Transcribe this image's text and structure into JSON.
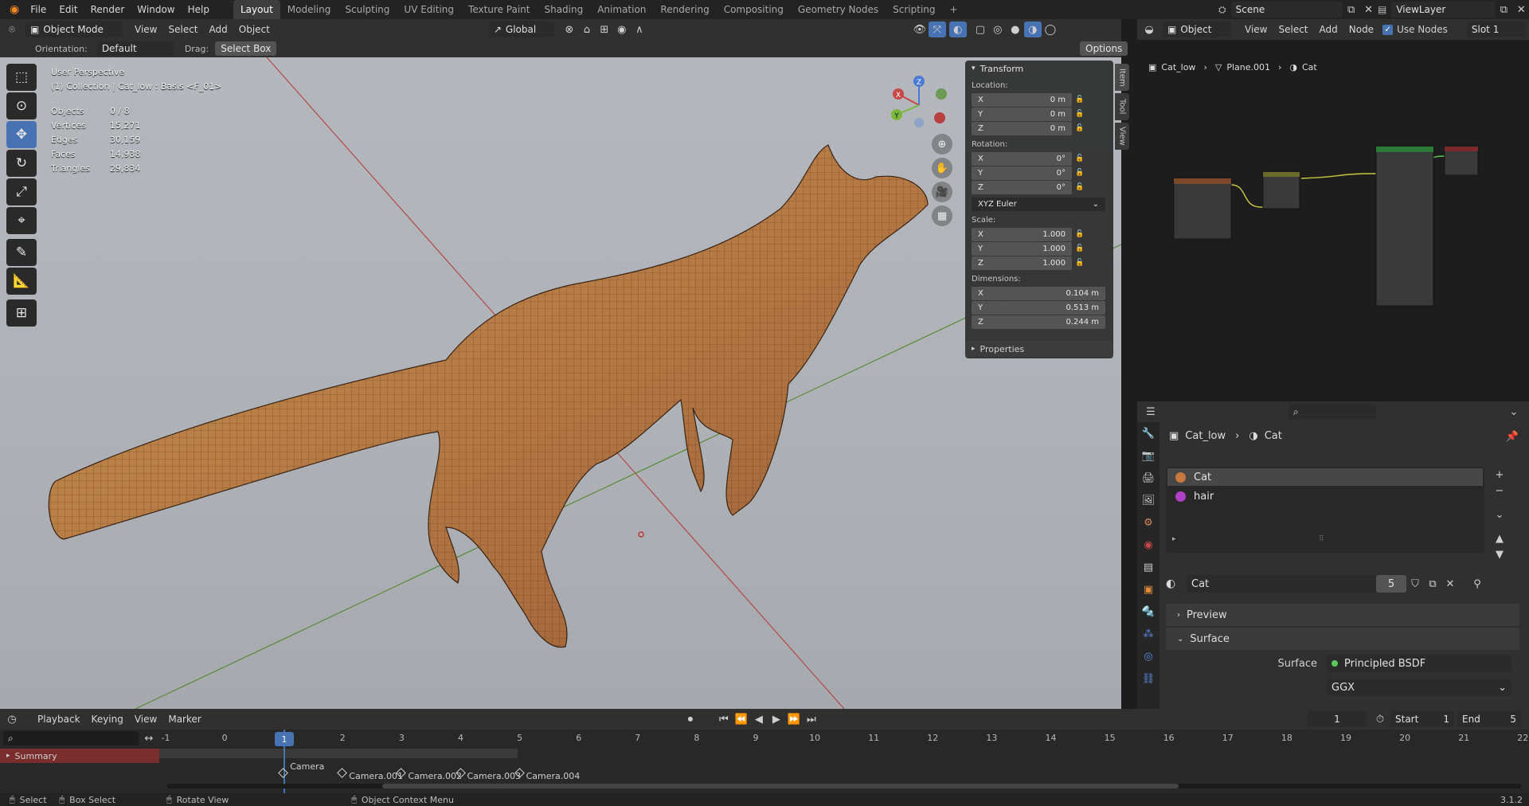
{
  "topbar": {
    "menus": [
      "File",
      "Edit",
      "Render",
      "Window",
      "Help"
    ],
    "workspaces": [
      "Layout",
      "Modeling",
      "Sculpting",
      "UV Editing",
      "Texture Paint",
      "Shading",
      "Animation",
      "Rendering",
      "Compositing",
      "Geometry Nodes",
      "Scripting"
    ],
    "active_workspace": "Layout",
    "scene": "Scene",
    "view_layer": "ViewLayer"
  },
  "viewport_header": {
    "mode": "Object Mode",
    "menus": [
      "View",
      "Select",
      "Add",
      "Object"
    ],
    "transform_orientation": "Global"
  },
  "tool_settings": {
    "orientation_label": "Orientation:",
    "orientation_value": "Default",
    "drag_label": "Drag:",
    "drag_value": "Select Box",
    "options": "Options"
  },
  "overlay": {
    "view_name": "User Perspective",
    "collection_path": "(1) Collection | Cat_low : Basis <F_01>",
    "stats": [
      {
        "label": "Objects",
        "value": "0 / 8"
      },
      {
        "label": "Vertices",
        "value": "15,271"
      },
      {
        "label": "Edges",
        "value": "30,159"
      },
      {
        "label": "Faces",
        "value": "14,938"
      },
      {
        "label": "Triangles",
        "value": "29,834"
      }
    ]
  },
  "gizmo_axes": {
    "x": "X",
    "y": "Y",
    "z": "Z"
  },
  "npanel": {
    "title": "Transform",
    "location_label": "Location:",
    "location": [
      {
        "axis": "X",
        "value": "0 m"
      },
      {
        "axis": "Y",
        "value": "0 m"
      },
      {
        "axis": "Z",
        "value": "0 m"
      }
    ],
    "rotation_label": "Rotation:",
    "rotation": [
      {
        "axis": "X",
        "value": "0°"
      },
      {
        "axis": "Y",
        "value": "0°"
      },
      {
        "axis": "Z",
        "value": "0°"
      }
    ],
    "rotation_mode": "XYZ Euler",
    "scale_label": "Scale:",
    "scale": [
      {
        "axis": "X",
        "value": "1.000"
      },
      {
        "axis": "Y",
        "value": "1.000"
      },
      {
        "axis": "Z",
        "value": "1.000"
      }
    ],
    "dimensions_label": "Dimensions:",
    "dimensions": [
      {
        "axis": "X",
        "value": "0.104 m"
      },
      {
        "axis": "Y",
        "value": "0.513 m"
      },
      {
        "axis": "Z",
        "value": "0.244 m"
      }
    ],
    "properties": "Properties",
    "tabs": [
      "Item",
      "Tool",
      "View"
    ]
  },
  "node_editor": {
    "type": "Object",
    "menus": [
      "View",
      "Select",
      "Add",
      "Node"
    ],
    "use_nodes": "Use Nodes",
    "slot": "Slot 1",
    "breadcrumb": [
      "Cat_low",
      "Plane.001",
      "Cat"
    ]
  },
  "properties": {
    "breadcrumb": [
      "Cat_low",
      "Cat"
    ],
    "material_slots": [
      {
        "name": "Cat",
        "color": "#c8783c"
      },
      {
        "name": "hair",
        "color": "#b040c8"
      }
    ],
    "material_name": "Cat",
    "user_count": "5",
    "panels": {
      "preview": "Preview",
      "surface": "Surface"
    },
    "surface_label": "Surface",
    "surface_value": "Principled BSDF",
    "distribution": "GGX"
  },
  "timeline": {
    "menus": [
      "Playback",
      "Keying",
      "View",
      "Marker"
    ],
    "current_frame": "1",
    "start_label": "Start",
    "start": "1",
    "end_label": "End",
    "end": "5",
    "ticks": [
      "-1",
      "0",
      "1",
      "2",
      "3",
      "4",
      "5",
      "6",
      "7",
      "8",
      "9",
      "10",
      "11",
      "12",
      "13",
      "14",
      "15",
      "16",
      "17",
      "18",
      "19",
      "20",
      "21",
      "22"
    ],
    "summary": "Summary",
    "markers": [
      "Camera",
      "Camera.001",
      "Camera.002",
      "Camera.003",
      "Camera.004"
    ]
  },
  "status_bar": {
    "items": [
      "Select",
      "Box Select",
      "Rotate View",
      "Object Context Menu"
    ],
    "version": "3.1.2"
  }
}
